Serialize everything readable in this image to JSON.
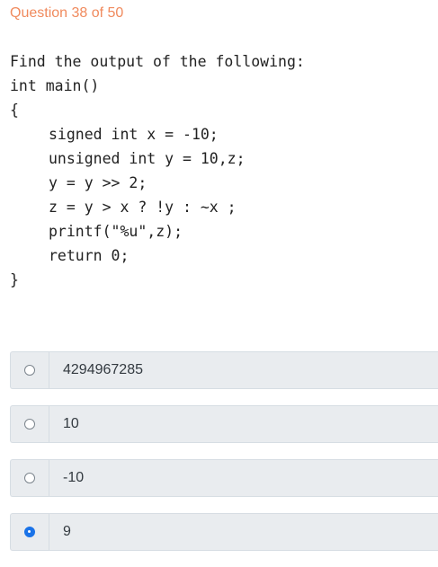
{
  "question": {
    "header": "Question 38 of 50"
  },
  "code": {
    "lines": [
      "Find the output of the following:",
      "int main()",
      "{",
      "signed int x = -10;",
      "unsigned int y = 10,z;",
      "y = y >> 2;",
      "z = y > x ? !y : ~x ;",
      "printf(\"%u\",z);",
      "return 0;",
      "}"
    ]
  },
  "options": [
    {
      "label": "4294967285",
      "selected": false
    },
    {
      "label": "10",
      "selected": false
    },
    {
      "label": "-10",
      "selected": false
    },
    {
      "label": "9",
      "selected": true
    }
  ],
  "colors": {
    "header": "#f08a5d",
    "selected_radio": "#1a73e8",
    "option_background": "#e9ecef"
  }
}
